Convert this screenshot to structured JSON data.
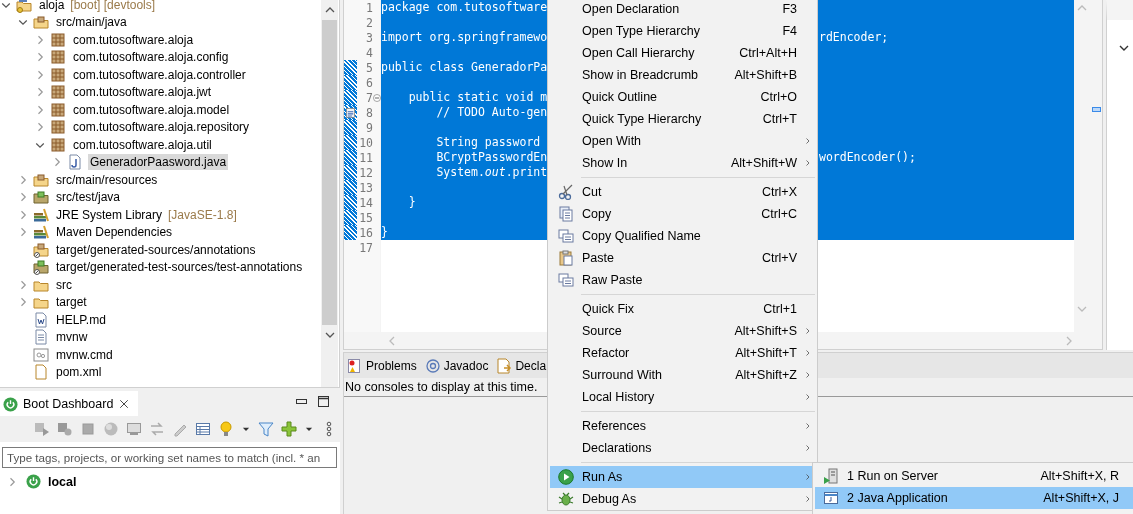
{
  "tree": [
    {
      "label": "aloja",
      "decoration": "[boot] [devtools]",
      "kind": "project",
      "expanded": true,
      "selected": false,
      "children": [
        {
          "label": "src/main/java",
          "kind": "source-folder",
          "expanded": true,
          "selected": false,
          "children": [
            {
              "label": "com.tutosoftware.aloja",
              "kind": "package",
              "expanded": false,
              "selected": false
            },
            {
              "label": "com.tutosoftware.aloja.config",
              "kind": "package",
              "expanded": false,
              "selected": false
            },
            {
              "label": "com.tutosoftware.aloja.controller",
              "kind": "package",
              "expanded": false,
              "selected": false
            },
            {
              "label": "com.tutosoftware.aloja.jwt",
              "kind": "package",
              "expanded": false,
              "selected": false
            },
            {
              "label": "com.tutosoftware.aloja.model",
              "kind": "package",
              "expanded": false,
              "selected": false
            },
            {
              "label": "com.tutosoftware.aloja.repository",
              "kind": "package",
              "expanded": false,
              "selected": false
            },
            {
              "label": "com.tutosoftware.aloja.util",
              "kind": "package",
              "expanded": true,
              "selected": false,
              "children": [
                {
                  "label": "GeneradorPaasword.java",
                  "kind": "java-file",
                  "expanded": false,
                  "selected": true
                }
              ]
            }
          ]
        },
        {
          "label": "src/main/resources",
          "kind": "source-folder",
          "expanded": false,
          "selected": false
        },
        {
          "label": "src/test/java",
          "kind": "test-folder",
          "expanded": false,
          "selected": false
        },
        {
          "label": "JRE System Library",
          "decoration": "[JavaSE-1.8]",
          "kind": "library",
          "expanded": false,
          "selected": false
        },
        {
          "label": "Maven Dependencies",
          "kind": "library",
          "expanded": false,
          "selected": false
        },
        {
          "label": "target/generated-sources/annotations",
          "kind": "generated-folder",
          "selected": false
        },
        {
          "label": "target/generated-test-sources/test-annotations",
          "kind": "generated-test-folder",
          "selected": false
        },
        {
          "label": "src",
          "kind": "folder",
          "expanded": false,
          "selected": false
        },
        {
          "label": "target",
          "kind": "folder",
          "expanded": false,
          "selected": false
        },
        {
          "label": "HELP.md",
          "kind": "markdown",
          "selected": false
        },
        {
          "label": "mvnw",
          "kind": "text",
          "selected": false
        },
        {
          "label": "mvnw.cmd",
          "kind": "cmd",
          "selected": false
        },
        {
          "label": "pom.xml",
          "kind": "xml",
          "selected": false
        }
      ]
    }
  ],
  "boot_dashboard": {
    "tab": "Boot Dashboard",
    "filter": {
      "placeholder": "Type tags, projects, or working set names to match (incl. * an"
    },
    "targets": [
      {
        "label": "local",
        "expanded": false
      }
    ]
  },
  "editor": {
    "lines": [
      {
        "number": "1",
        "text": "package com.tutosoftware",
        "kind": "plain",
        "selected": true,
        "changed": false
      },
      {
        "number": "2",
        "kind": "plain",
        "selected": true,
        "changed": false
      },
      {
        "number": "3",
        "text": "import org.springframewo",
        "tail": "rdEncoder;",
        "kind": "plain",
        "selected": true,
        "changed": false
      },
      {
        "number": "4",
        "kind": "plain",
        "selected": true,
        "changed": false
      },
      {
        "number": "5",
        "text": "public class GeneradorPa",
        "kind": "plain",
        "selected": true,
        "changed": true
      },
      {
        "number": "6",
        "kind": "plain",
        "selected": true,
        "changed": true
      },
      {
        "number": "7",
        "text": "    public static void m",
        "kind": "fold",
        "selected": true,
        "changed": true
      },
      {
        "number": "8",
        "text": "        // TODO Auto-gen",
        "kind": "task",
        "selected": true,
        "changed": true
      },
      {
        "number": "9",
        "kind": "plain",
        "selected": true,
        "changed": true
      },
      {
        "number": "10",
        "text": "        String password ",
        "kind": "plain",
        "selected": true,
        "changed": true
      },
      {
        "number": "11",
        "text": "        BCryptPasswordEn",
        "tail": "wordEncoder();",
        "kind": "plain",
        "selected": true,
        "changed": true
      },
      {
        "number": "12",
        "text": "        System.*out*.print",
        "kind": "plain",
        "selected": true,
        "changed": true
      },
      {
        "number": "13",
        "kind": "plain",
        "selected": true,
        "changed": true
      },
      {
        "number": "14",
        "text": "    }",
        "kind": "plain",
        "selected": true,
        "changed": true
      },
      {
        "number": "15",
        "kind": "plain",
        "selected": true,
        "changed": true
      },
      {
        "number": "16",
        "text": "}",
        "kind": "plain",
        "selected": true,
        "changed": true
      },
      {
        "number": "17",
        "kind": "plain",
        "selected": false,
        "changed": false
      }
    ]
  },
  "bottom_panel": {
    "tabs": [
      {
        "label": "Problems",
        "kind": "problems"
      },
      {
        "label": "Javadoc",
        "kind": "javadoc"
      },
      {
        "label": "Decla",
        "kind": "declaration"
      }
    ],
    "message": "No consoles to display at this time."
  },
  "context_menu": {
    "items": [
      {
        "kind": "plain",
        "label": "Open Declaration",
        "shortcut": "F3",
        "submenu": false,
        "selected": false
      },
      {
        "kind": "plain",
        "label": "Open Type Hierarchy",
        "shortcut": "F4",
        "submenu": false,
        "selected": false
      },
      {
        "kind": "plain",
        "label": "Open Call Hierarchy",
        "shortcut": "Ctrl+Alt+H",
        "submenu": false,
        "selected": false
      },
      {
        "kind": "plain",
        "label": "Show in Breadcrumb",
        "shortcut": "Alt+Shift+B",
        "submenu": false,
        "selected": false
      },
      {
        "kind": "plain",
        "label": "Quick Outline",
        "shortcut": "Ctrl+O",
        "submenu": false,
        "selected": false
      },
      {
        "kind": "plain",
        "label": "Quick Type Hierarchy",
        "shortcut": "Ctrl+T",
        "submenu": false,
        "selected": false
      },
      {
        "kind": "plain",
        "label": "Open With",
        "submenu": true,
        "selected": false
      },
      {
        "kind": "plain",
        "label": "Show In",
        "shortcut": "Alt+Shift+W",
        "submenu": true,
        "selected": false
      },
      {
        "kind": "separator"
      },
      {
        "kind": "cut",
        "label": "Cut",
        "shortcut": "Ctrl+X",
        "submenu": false,
        "selected": false
      },
      {
        "kind": "copy",
        "label": "Copy",
        "shortcut": "Ctrl+C",
        "submenu": false,
        "selected": false
      },
      {
        "kind": "copy-name",
        "label": "Copy Qualified Name",
        "submenu": false,
        "selected": false
      },
      {
        "kind": "paste",
        "label": "Paste",
        "shortcut": "Ctrl+V",
        "submenu": false,
        "selected": false
      },
      {
        "kind": "copy-name",
        "label": "Raw Paste",
        "submenu": false,
        "selected": false
      },
      {
        "kind": "separator"
      },
      {
        "kind": "plain",
        "label": "Quick Fix",
        "shortcut": "Ctrl+1",
        "submenu": false,
        "selected": false
      },
      {
        "kind": "plain",
        "label": "Source",
        "shortcut": "Alt+Shift+S",
        "submenu": true,
        "selected": false
      },
      {
        "kind": "plain",
        "label": "Refactor",
        "shortcut": "Alt+Shift+T",
        "submenu": true,
        "selected": false
      },
      {
        "kind": "plain",
        "label": "Surround With",
        "shortcut": "Alt+Shift+Z",
        "submenu": true,
        "selected": false
      },
      {
        "kind": "plain",
        "label": "Local History",
        "submenu": true,
        "selected": false
      },
      {
        "kind": "separator"
      },
      {
        "kind": "plain",
        "label": "References",
        "submenu": true,
        "selected": false
      },
      {
        "kind": "plain",
        "label": "Declarations",
        "submenu": true,
        "selected": false
      },
      {
        "kind": "separator"
      },
      {
        "kind": "run",
        "label": "Run As",
        "submenu": true,
        "selected": true
      },
      {
        "kind": "debug",
        "label": "Debug As",
        "submenu": true,
        "selected": false
      }
    ]
  },
  "submenu": {
    "items": [
      {
        "kind": "server",
        "label": "1 Run on Server",
        "shortcut": "Alt+Shift+X, R",
        "selected": false
      },
      {
        "kind": "java-app",
        "label": "2 Java Application",
        "shortcut": "Alt+Shift+X, J",
        "selected": true
      }
    ]
  }
}
